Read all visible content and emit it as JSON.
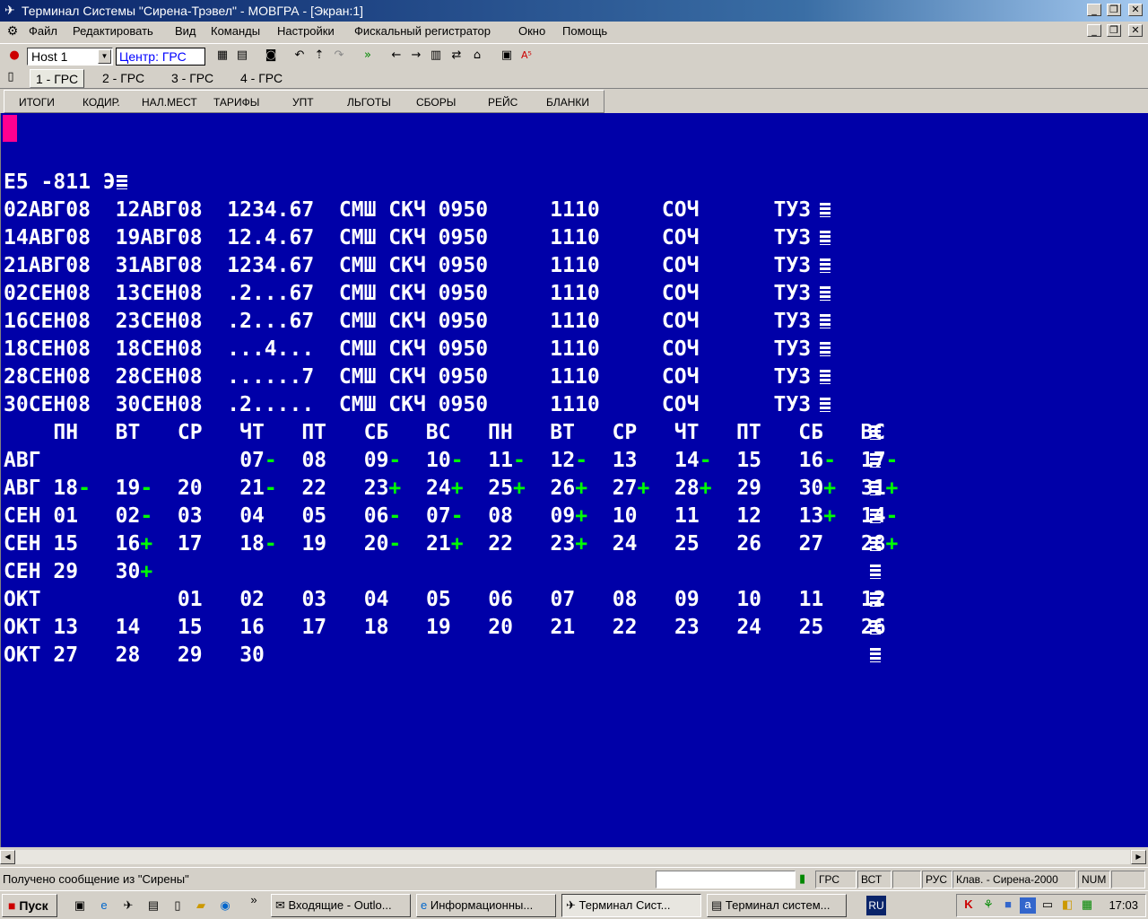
{
  "window": {
    "title": "Терминал Системы \"Сирена-Трэвел\" - МОВГРА - [Экран:1]"
  },
  "menu": [
    "Файл",
    "Редактировать",
    "Вид",
    "Команды",
    "Настройки",
    "Фискальный регистратор",
    "Окно",
    "Помощь"
  ],
  "toolbar": {
    "host_value": "Host 1",
    "center_label": "Центр: ГРС"
  },
  "tabs": [
    "1 - ГРС",
    "2 - ГРС",
    "3 - ГРС",
    "4 - ГРС"
  ],
  "function_buttons": [
    "ИТОГИ",
    "КОДИР.",
    "НАЛ.МЕСТ",
    "ТАРИФЫ",
    "УПТ",
    "ЛЬГОТЫ",
    "СБОРЫ",
    "РЕЙС",
    "БЛАНКИ"
  ],
  "terminal": {
    "header": "E5 -811 Э",
    "schedule": [
      {
        "from": "02АВГ08",
        "to": "12АВГ08",
        "days": "1234.67",
        "orig": "СМШ",
        "dest": "СКЧ",
        "dep": "0950",
        "arr": "1110",
        "ac": "СОЧ",
        "equip": "ТУЗ"
      },
      {
        "from": "14АВГ08",
        "to": "19АВГ08",
        "days": "12.4.67",
        "orig": "СМШ",
        "dest": "СКЧ",
        "dep": "0950",
        "arr": "1110",
        "ac": "СОЧ",
        "equip": "ТУЗ"
      },
      {
        "from": "21АВГ08",
        "to": "31АВГ08",
        "days": "1234.67",
        "orig": "СМШ",
        "dest": "СКЧ",
        "dep": "0950",
        "arr": "1110",
        "ac": "СОЧ",
        "equip": "ТУЗ"
      },
      {
        "from": "02СЕН08",
        "to": "13СЕН08",
        "days": ".2...67",
        "orig": "СМШ",
        "dest": "СКЧ",
        "dep": "0950",
        "arr": "1110",
        "ac": "СОЧ",
        "equip": "ТУЗ"
      },
      {
        "from": "16СЕН08",
        "to": "23СЕН08",
        "days": ".2...67",
        "orig": "СМШ",
        "dest": "СКЧ",
        "dep": "0950",
        "arr": "1110",
        "ac": "СОЧ",
        "equip": "ТУЗ"
      },
      {
        "from": "18СЕН08",
        "to": "18СЕН08",
        "days": "...4...",
        "orig": "СМШ",
        "dest": "СКЧ",
        "dep": "0950",
        "arr": "1110",
        "ac": "СОЧ",
        "equip": "ТУЗ"
      },
      {
        "from": "28СЕН08",
        "to": "28СЕН08",
        "days": "......7",
        "orig": "СМШ",
        "dest": "СКЧ",
        "dep": "0950",
        "arr": "1110",
        "ac": "СОЧ",
        "equip": "ТУЗ"
      },
      {
        "from": "30СЕН08",
        "to": "30СЕН08",
        "days": ".2.....",
        "orig": "СМШ",
        "dest": "СКЧ",
        "dep": "0950",
        "arr": "1110",
        "ac": "СОЧ",
        "equip": "ТУЗ"
      }
    ],
    "weekday_header": [
      "ПН",
      "ВТ",
      "СР",
      "ЧТ",
      "ПТ",
      "СБ",
      "ВС",
      "ПН",
      "ВТ",
      "СР",
      "ЧТ",
      "ПТ",
      "СБ",
      "ВС"
    ],
    "calendar": [
      {
        "month": "АВГ",
        "cells": [
          [
            "",
            ""
          ],
          [
            "",
            ""
          ],
          [
            "",
            ""
          ],
          [
            "07",
            "-"
          ],
          [
            "08",
            ""
          ],
          [
            "09",
            "-"
          ],
          [
            "10",
            "-"
          ],
          [
            "11",
            "-"
          ],
          [
            "12",
            "-"
          ],
          [
            "13",
            ""
          ],
          [
            "14",
            "-"
          ],
          [
            "15",
            ""
          ],
          [
            "16",
            "-"
          ],
          [
            "17",
            "-"
          ]
        ]
      },
      {
        "month": "АВГ",
        "cells": [
          [
            "18",
            "-"
          ],
          [
            "19",
            "-"
          ],
          [
            "20",
            ""
          ],
          [
            "21",
            "-"
          ],
          [
            "22",
            ""
          ],
          [
            "23",
            "+"
          ],
          [
            "24",
            "+"
          ],
          [
            "25",
            "+"
          ],
          [
            "26",
            "+"
          ],
          [
            "27",
            "+"
          ],
          [
            "28",
            "+"
          ],
          [
            "29",
            ""
          ],
          [
            "30",
            "+"
          ],
          [
            "31",
            "+"
          ]
        ]
      },
      {
        "month": "СЕН",
        "cells": [
          [
            "01",
            ""
          ],
          [
            "02",
            "-"
          ],
          [
            "03",
            ""
          ],
          [
            "04",
            ""
          ],
          [
            "05",
            ""
          ],
          [
            "06",
            "-"
          ],
          [
            "07",
            "-"
          ],
          [
            "08",
            ""
          ],
          [
            "09",
            "+"
          ],
          [
            "10",
            ""
          ],
          [
            "11",
            ""
          ],
          [
            "12",
            ""
          ],
          [
            "13",
            "+"
          ],
          [
            "14",
            "-"
          ]
        ]
      },
      {
        "month": "СЕН",
        "cells": [
          [
            "15",
            ""
          ],
          [
            "16",
            "+"
          ],
          [
            "17",
            ""
          ],
          [
            "18",
            "-"
          ],
          [
            "19",
            ""
          ],
          [
            "20",
            "-"
          ],
          [
            "21",
            "+"
          ],
          [
            "22",
            ""
          ],
          [
            "23",
            "+"
          ],
          [
            "24",
            ""
          ],
          [
            "25",
            ""
          ],
          [
            "26",
            ""
          ],
          [
            "27",
            ""
          ],
          [
            "28",
            "+"
          ]
        ]
      },
      {
        "month": "СЕН",
        "cells": [
          [
            "29",
            ""
          ],
          [
            "30",
            "+"
          ]
        ]
      },
      {
        "month": "ОКТ",
        "cells": [
          [
            "",
            ""
          ],
          [
            "",
            ""
          ],
          [
            "01",
            ""
          ],
          [
            "02",
            ""
          ],
          [
            "03",
            ""
          ],
          [
            "04",
            ""
          ],
          [
            "05",
            ""
          ],
          [
            "06",
            ""
          ],
          [
            "07",
            ""
          ],
          [
            "08",
            ""
          ],
          [
            "09",
            ""
          ],
          [
            "10",
            ""
          ],
          [
            "11",
            ""
          ],
          [
            "12",
            ""
          ]
        ]
      },
      {
        "month": "ОКТ",
        "cells": [
          [
            "13",
            ""
          ],
          [
            "14",
            ""
          ],
          [
            "15",
            ""
          ],
          [
            "16",
            ""
          ],
          [
            "17",
            ""
          ],
          [
            "18",
            ""
          ],
          [
            "19",
            ""
          ],
          [
            "20",
            ""
          ],
          [
            "21",
            ""
          ],
          [
            "22",
            ""
          ],
          [
            "23",
            ""
          ],
          [
            "24",
            ""
          ],
          [
            "25",
            ""
          ],
          [
            "26",
            ""
          ]
        ]
      },
      {
        "month": "ОКТ",
        "cells": [
          [
            "27",
            ""
          ],
          [
            "28",
            ""
          ],
          [
            "29",
            ""
          ],
          [
            "30",
            ""
          ]
        ]
      }
    ]
  },
  "statusbar": {
    "message": "Получено сообщение из \"Сирены\"",
    "grs": "ГРС",
    "vst": "ВСТ",
    "rus": "РУС",
    "keyboard": "Клав. - Сирена-2000",
    "num": "NUM"
  },
  "taskbar": {
    "start": "Пуск",
    "items": [
      "Входящие - Outlo...",
      "Информационны...",
      "Терминал Сист...",
      "Терминал систем..."
    ],
    "lang": "RU",
    "clock": "17:03"
  },
  "colors": {
    "terminal_bg": "#0000a8",
    "terminal_fg": "#ffffff",
    "marker": "#00ff00",
    "cursor": "#ff0090"
  }
}
